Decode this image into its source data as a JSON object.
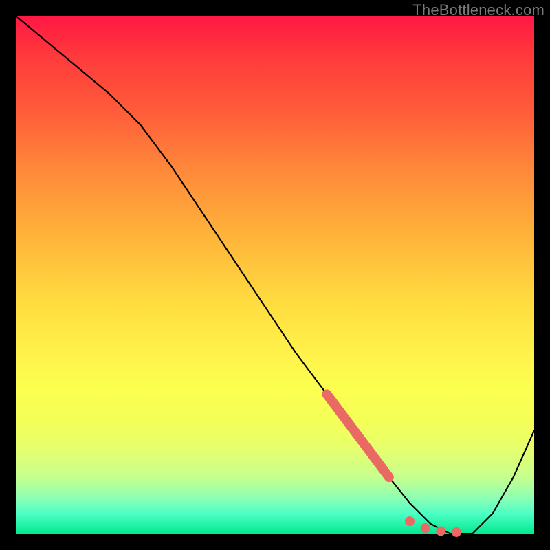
{
  "watermark": "TheBottleneck.com",
  "colors": {
    "frame": "#000000",
    "curve": "#000000",
    "marker": "#e96a63"
  },
  "chart_data": {
    "type": "line",
    "title": "",
    "xlabel": "",
    "ylabel": "",
    "xlim": [
      0,
      100
    ],
    "ylim": [
      0,
      100
    ],
    "series": [
      {
        "name": "curve",
        "x": [
          0,
          6,
          12,
          18,
          24,
          30,
          36,
          42,
          48,
          54,
          60,
          66,
          72,
          76,
          80,
          84,
          88,
          92,
          96,
          100
        ],
        "y": [
          100,
          95,
          90,
          85,
          79,
          71,
          62,
          53,
          44,
          35,
          27,
          19,
          11,
          6,
          2,
          0,
          0,
          4,
          11,
          20
        ]
      }
    ],
    "markers": {
      "thick_segment": {
        "x": [
          60,
          72
        ],
        "y": [
          27,
          11
        ]
      },
      "dots": [
        {
          "x": 76,
          "y": 2.5
        },
        {
          "x": 79,
          "y": 1.2
        },
        {
          "x": 82,
          "y": 0.6
        },
        {
          "x": 85,
          "y": 0.4
        }
      ]
    }
  }
}
